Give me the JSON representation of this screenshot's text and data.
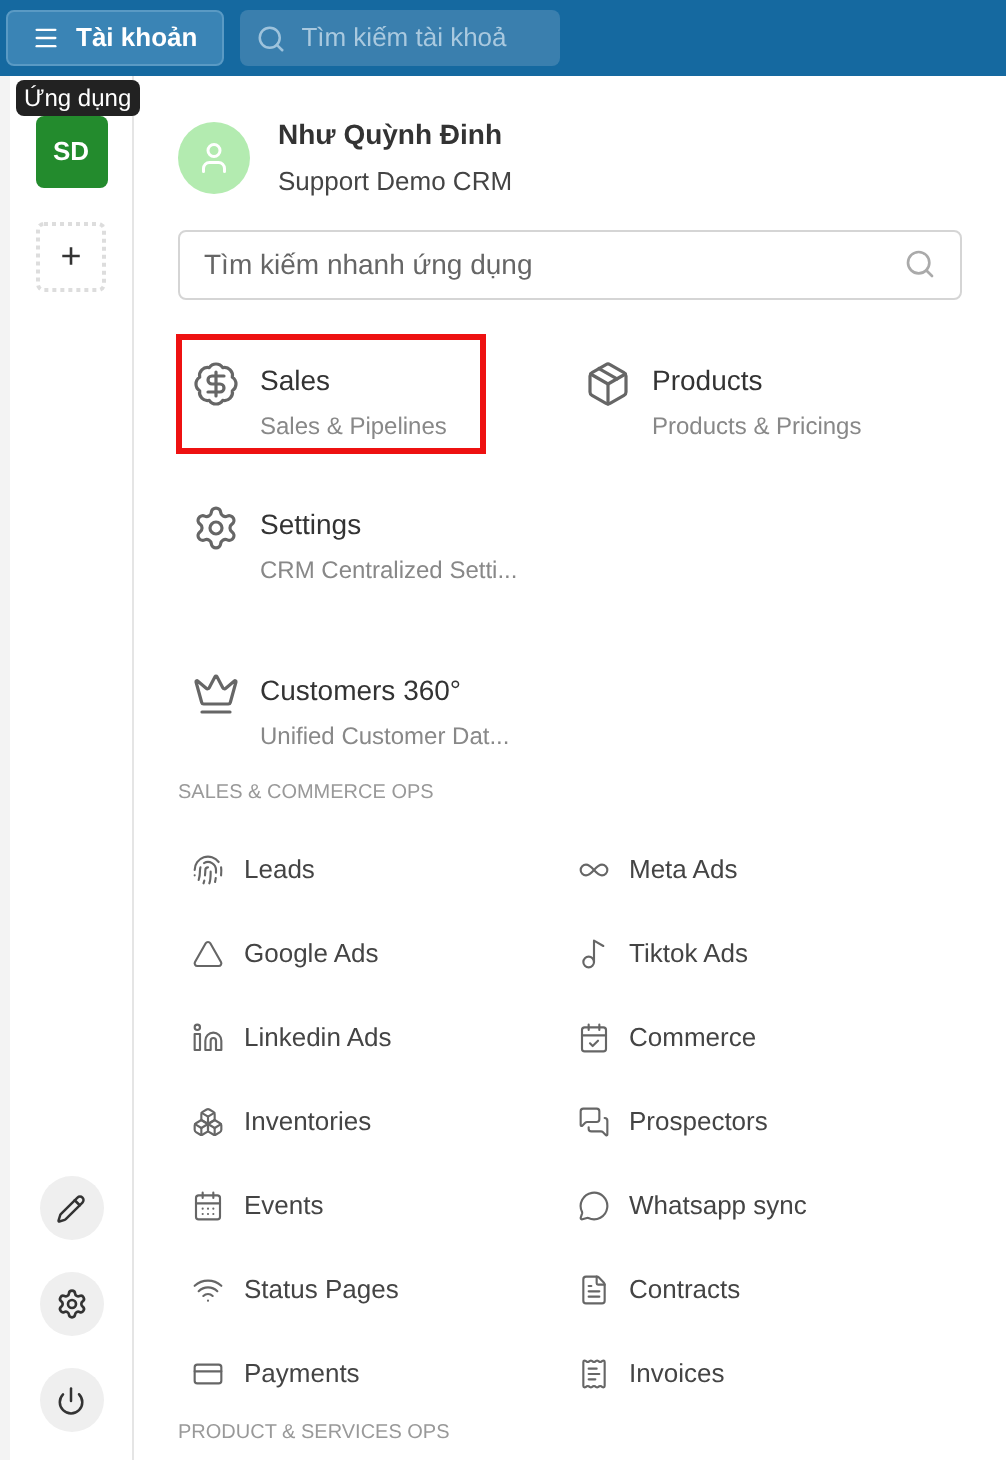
{
  "top_bar": {
    "menu_button": "Tài khoản",
    "search": {
      "placeholder": "Tìm kiếm tài khoả"
    }
  },
  "rail": {
    "tooltip": "Ứng dụng",
    "workspace": "SD",
    "add": "+"
  },
  "profile": {
    "name": "Như Quỳnh Đinh",
    "org": "Support Demo CRM"
  },
  "app_search": {
    "placeholder": "Tìm kiếm nhanh ứng dụng"
  },
  "apps": [
    {
      "title": "Sales",
      "subtitle": "Sales & Pipelines",
      "selected": true
    },
    {
      "title": "Products",
      "subtitle": "Products & Pricings",
      "selected": false
    },
    {
      "title": "Settings",
      "subtitle": "CRM Centralized Setti...",
      "selected": false
    },
    {
      "title": "Customers 360°",
      "subtitle": "Unified Customer Dat...",
      "selected": false
    }
  ],
  "sections": [
    {
      "heading": "SALES & COMMERCE OPS",
      "items": [
        "Leads",
        "Meta Ads",
        "Google Ads",
        "Tiktok Ads",
        "Linkedin Ads",
        "Commerce",
        "Inventories",
        "Prospectors",
        "Events",
        "Whatsapp sync",
        "Status Pages",
        "Contracts",
        "Payments",
        "Invoices"
      ]
    },
    {
      "heading": "PRODUCT & SERVICES OPS"
    }
  ]
}
